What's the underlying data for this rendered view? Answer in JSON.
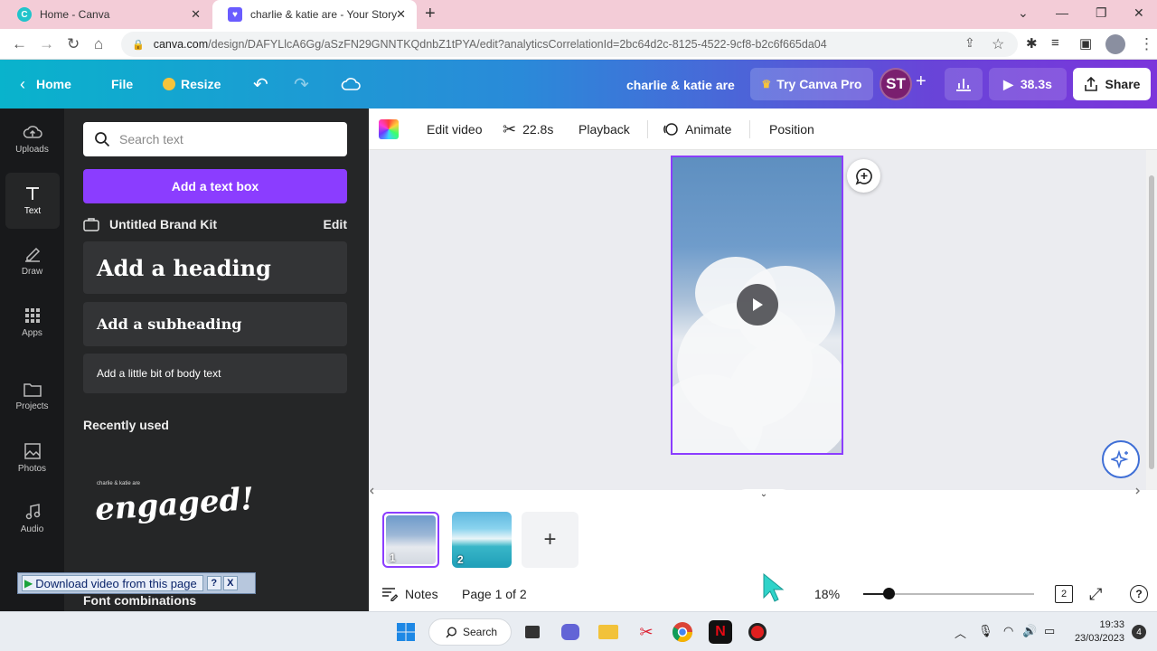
{
  "browser": {
    "tabs": [
      {
        "title": "Home - Canva",
        "active": false
      },
      {
        "title": "charlie & katie are - Your Story",
        "active": true
      }
    ],
    "url_domain": "canva.com",
    "url_path": "/design/DAFYLlcA6Gg/aSzFN29GNNTKQdnbZ1tPYA/edit?analyticsCorrelationId=2bc64d2c-8125-4522-9cf8-b2c6f665da04"
  },
  "header": {
    "home": "Home",
    "file": "File",
    "resize": "Resize",
    "design_title": "charlie & katie are",
    "try_pro": "Try Canva Pro",
    "avatar_initials": "ST",
    "duration": "38.3s",
    "share": "Share",
    "colors": {
      "gradient_start": "#09b3cc",
      "gradient_end": "#7b35db",
      "accent": "#8b3dff"
    }
  },
  "rail": {
    "items": [
      {
        "label": "Uploads",
        "icon": "upload-cloud-icon"
      },
      {
        "label": "Text",
        "icon": "text-t-icon",
        "active": true
      },
      {
        "label": "Draw",
        "icon": "draw-pen-icon"
      },
      {
        "label": "Apps",
        "icon": "apps-grid-icon"
      },
      {
        "label": "Projects",
        "icon": "folder-icon"
      },
      {
        "label": "Photos",
        "icon": "photo-icon"
      },
      {
        "label": "Audio",
        "icon": "music-note-icon"
      }
    ]
  },
  "panel": {
    "search_placeholder": "Search text",
    "add_text_box": "Add a text box",
    "brand_kit": "Untitled Brand Kit",
    "brand_kit_edit": "Edit",
    "heading": "Add a heading",
    "subheading": "Add a subheading",
    "body": "Add a little bit of body text",
    "recently_used": "Recently used",
    "recent_small": "charlie & katie are",
    "recent_script": "engaged!",
    "font_combinations": "Font combinations"
  },
  "download_bar": {
    "label": "Download video from this page",
    "help": "?",
    "close": "X"
  },
  "toolbar": {
    "edit_video": "Edit video",
    "trim_time": "22.8s",
    "playback": "Playback",
    "animate": "Animate",
    "position": "Position"
  },
  "pages": {
    "thumbs": [
      {
        "num": "1",
        "selected": true
      },
      {
        "num": "2",
        "selected": false
      }
    ],
    "add": "+"
  },
  "footer": {
    "notes": "Notes",
    "page_indicator": "Page 1 of 2",
    "zoom": "18%",
    "zoom_fraction": 0.15,
    "page_count_badge": "2",
    "help": "?"
  },
  "taskbar": {
    "search": "Search",
    "time": "19:33",
    "date": "23/03/2023",
    "notifications": "4"
  }
}
